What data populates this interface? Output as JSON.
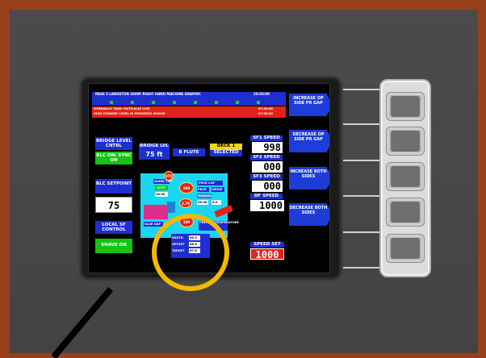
{
  "screen": {
    "header": {
      "title": "PAGE 5  LANGSTON 2000F RIGHT HAND MACHINE GRAPHIC",
      "time": "20:50:08"
    },
    "alarms": {
      "line1": "HYDRAULIC TANK CRITICALLY LOW",
      "line1_time": "07:52:00",
      "line2": "HIGH STANDBY LEVEL IN PROGRESS 000000",
      "line2_time": "07:50:00"
    },
    "bridge_level": {
      "title": "BRIDGE LEVEL CNTRL",
      "sync_label": "BLC ON/ SYNC ON",
      "setpoint_title": "BLC SETPOINT",
      "setpoint_value": "75"
    },
    "local_sf": {
      "title": "LOCAL SF CONTROL",
      "status": "SHAVE ON"
    },
    "bridge_lvl": {
      "label": "BRIDGE LVL",
      "value": "75 ft",
      "flute": "B FLUTE"
    },
    "deck": {
      "label": "DECK 1",
      "selected": "SELECTED"
    },
    "speeds": {
      "sf1_label": "SF1 SPEED",
      "sf1_value": "998",
      "sf2_label": "SF2 SPEED",
      "sf2_value": "000",
      "sf3_label": "SF3 SPEED",
      "sf3_value": "000",
      "df_label": "DF SPEED",
      "df_value": "1000",
      "set_label": "SPEED SET",
      "set_value": "1000"
    },
    "diagram": {
      "gauge_top": "070",
      "guide_cap": "GUIDE CAP",
      "auto": "AUTO",
      "auto_val": "10.00",
      "glue_red": "588",
      "press_cap": "PRCR CAP",
      "prcr": "PRCR",
      "drive": "DRIVE",
      "manual": "MANUAL",
      "speed1": "00.00",
      "speed2": "0.0",
      "red_c": "2.70",
      "valve": "330",
      "motor": "ON/OFF",
      "glue_note": "GLUE GAP",
      "preheat": "PREHEAT/TEMPERATURE",
      "width_label": "WIDTH",
      "offset_label": "OFFSET",
      "target_label": "TARGET",
      "width_val": "00.0",
      "offset_val": "88.8",
      "target_val": "87.8",
      "temp_label": "TEMPERATURE",
      "small_top": "COVERED"
    },
    "side_buttons": [
      {
        "label": "INCREASE OP SIDE PR GAP"
      },
      {
        "label": "DECREASE OP SIDE PR GAP"
      },
      {
        "label": "INCREASE BOTH SIDES"
      },
      {
        "label": "DECREASE BOTH SIDES"
      }
    ]
  },
  "colors": {
    "frame": "#9a3f1c",
    "wall": "#474747",
    "highlight": "#f5b800",
    "screen_blue": "#1e2fd0",
    "status_green": "#14c314",
    "alarm_red": "#e2231a"
  }
}
